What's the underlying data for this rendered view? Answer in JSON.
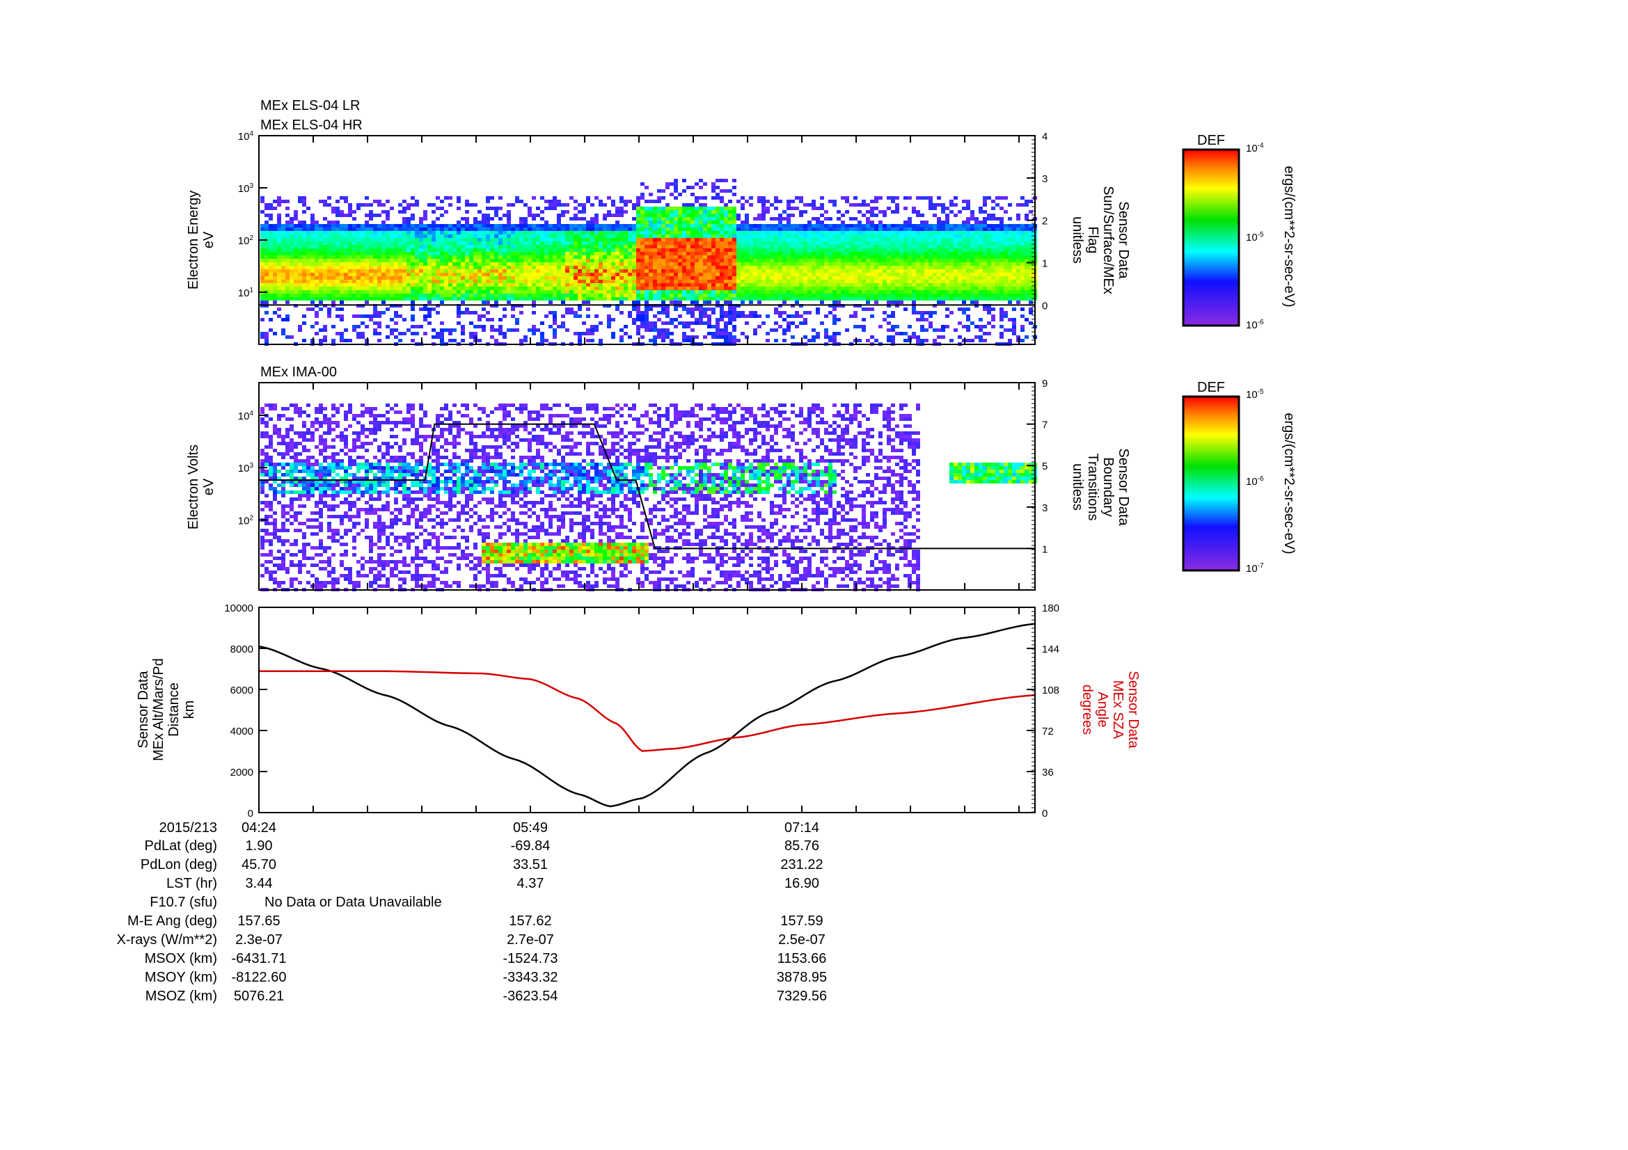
{
  "colors": {
    "axis": "#000000",
    "sza_line": "#d40000",
    "alt_line": "#000000"
  },
  "chart_data": [
    {
      "type": "heatmap",
      "titles": [
        "MEx ELS-04 LR",
        "MEx ELS-04 HR"
      ],
      "ylabel": [
        "Electron Energy",
        "eV"
      ],
      "yscale": "log",
      "ylim": [
        1,
        10000
      ],
      "yticks": [
        {
          "exp": "4"
        },
        {
          "exp": "3"
        },
        {
          "exp": "2"
        },
        {
          "exp": "1"
        }
      ],
      "ytick_values": [
        10000,
        1000,
        100,
        10
      ],
      "y2label": [
        "Sensor Data",
        "Sun/Surface/MEx",
        "Flag",
        "unitless"
      ],
      "y2lim": [
        -0.93,
        4
      ],
      "y2ticks": [
        "4",
        "3",
        "2",
        "1",
        "0"
      ],
      "y2tick_values": [
        4,
        3,
        2,
        1,
        0
      ],
      "overlay_line": {
        "name": "Sun/Surface/MEx Flag",
        "t_min": [
          0,
          243
        ],
        "values": [
          0,
          0
        ]
      },
      "colorbar": {
        "title": "DEF",
        "range": [
          1e-06,
          0.0001
        ],
        "ticks": [
          {
            "exp": "-4"
          },
          {
            "exp": "-5"
          },
          {
            "exp": "-6"
          }
        ],
        "unit": "ergs/(cm**2-sr-sec-eV)"
      }
    },
    {
      "type": "heatmap",
      "titles": [
        "MEx IMA-00"
      ],
      "ylabel": [
        "Electron Volts",
        "eV"
      ],
      "yscale": "log",
      "ylim": [
        4.6,
        42000
      ],
      "yticks": [
        {
          "exp": "4"
        },
        {
          "exp": "3"
        },
        {
          "exp": "2"
        }
      ],
      "ytick_values": [
        10000,
        1000,
        100
      ],
      "y2label": [
        "Sensor Data",
        "Boundary",
        "Transitions",
        "unitless"
      ],
      "y2lim": [
        -1,
        9
      ],
      "y2ticks": [
        "9",
        "7",
        "5",
        "3",
        "1"
      ],
      "y2tick_values": [
        9,
        7,
        5,
        3,
        1
      ],
      "overlay_line": {
        "name": "Boundary Transitions",
        "t_min": [
          0,
          52,
          55,
          80,
          84,
          105,
          112,
          118,
          124,
          243
        ],
        "values": [
          4.3,
          4.3,
          7,
          7,
          7,
          7,
          4.3,
          4.3,
          1,
          1
        ]
      },
      "colorbar": {
        "title": "DEF",
        "range": [
          1e-07,
          1e-05
        ],
        "ticks": [
          {
            "exp": "-5"
          },
          {
            "exp": "-6"
          },
          {
            "exp": "-7"
          }
        ],
        "unit": "ergs/(cm**2-sr-sec-eV)"
      }
    },
    {
      "type": "line",
      "ylabel": [
        "Sensor Data",
        "MEx Alt/Mars/Pd",
        "Distance",
        "km"
      ],
      "ylim": [
        0,
        10000
      ],
      "yticks": [
        "10000",
        "8000",
        "6000",
        "4000",
        "2000",
        "0"
      ],
      "ytick_values": [
        10000,
        8000,
        6000,
        4000,
        2000,
        0
      ],
      "y2label": [
        "Sensor Data",
        "MEx SZA",
        "Angle",
        "degrees"
      ],
      "y2lim": [
        0,
        180
      ],
      "y2ticks": [
        "180",
        "144",
        "108",
        "72",
        "36",
        "0"
      ],
      "y2tick_values": [
        180,
        144,
        108,
        72,
        36,
        0
      ],
      "xlim_minutes_after_0424": [
        0,
        243
      ],
      "series": [
        {
          "name": "MEx Alt/Mars/Pd Distance (km)",
          "axis": "left",
          "t_min": [
            0,
            20,
            40,
            60,
            80,
            100,
            110,
            120,
            140,
            160,
            180,
            200,
            220,
            243
          ],
          "values": [
            8100,
            7000,
            5700,
            4200,
            2600,
            900,
            300,
            700,
            2900,
            4900,
            6400,
            7600,
            8500,
            9200
          ]
        },
        {
          "name": "MEx SZA Angle (degrees)",
          "axis": "right",
          "t_min": [
            0,
            40,
            70,
            85,
            100,
            112,
            120,
            130,
            150,
            170,
            200,
            243
          ],
          "values": [
            124,
            124,
            122,
            117,
            100,
            78,
            54,
            56,
            66,
            77,
            87,
            103
          ]
        }
      ]
    }
  ],
  "time_axis": {
    "row_label": "2015/213",
    "ticks": [
      "04:24",
      "05:49",
      "07:14"
    ]
  },
  "ephemeris": [
    {
      "label": "PdLat (deg)",
      "values": [
        "1.90",
        "-69.84",
        "85.76"
      ]
    },
    {
      "label": "PdLon (deg)",
      "values": [
        "45.70",
        "33.51",
        "231.22"
      ]
    },
    {
      "label": "LST (hr)",
      "values": [
        "3.44",
        "4.37",
        "16.90"
      ]
    },
    {
      "label": "F10.7 (sfu)",
      "values": [
        "No Data or Data Unavailable"
      ]
    },
    {
      "label": "M-E Ang (deg)",
      "values": [
        "157.65",
        "157.62",
        "157.59"
      ]
    },
    {
      "label": "X-rays (W/m**2)",
      "values": [
        "2.3e-07",
        "2.7e-07",
        "2.5e-07"
      ]
    },
    {
      "label": "MSOX (km)",
      "values": [
        "-6431.71",
        "-1524.73",
        "1153.66"
      ]
    },
    {
      "label": "MSOY (km)",
      "values": [
        "-8122.60",
        "-3343.32",
        "3878.95"
      ]
    },
    {
      "label": "MSOZ (km)",
      "values": [
        "5076.21",
        "-3623.54",
        "7329.56"
      ]
    }
  ]
}
